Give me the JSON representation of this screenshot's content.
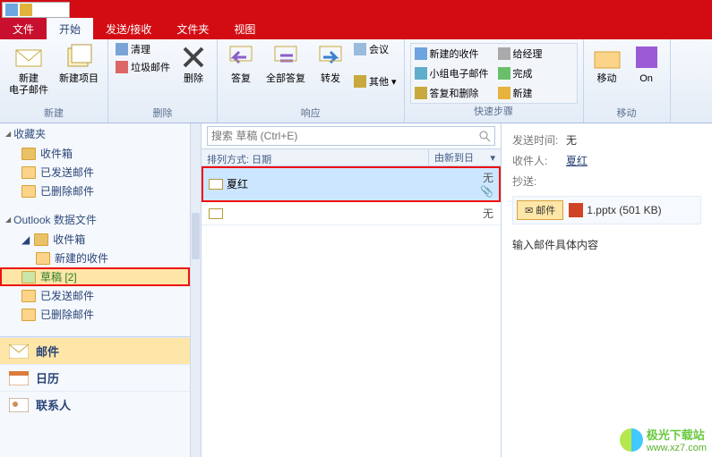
{
  "tabs": {
    "file": "文件",
    "home": "开始",
    "sendrecv": "发送/接收",
    "folder": "文件夹",
    "view": "视图"
  },
  "ribbon": {
    "new": {
      "label": "新建",
      "newmail": "新建\n电子邮件",
      "newitem": "新建项目"
    },
    "delete": {
      "label": "删除",
      "clean": "清理",
      "junk": "垃圾邮件",
      "del": "删除"
    },
    "respond": {
      "label": "响应",
      "reply": "答复",
      "replyall": "全部答复",
      "forward": "转发",
      "meeting": "会议",
      "other": "其他"
    },
    "quick": {
      "label": "快速步骤",
      "movemsg": "新建的收件",
      "team": "小组电子邮件",
      "replydel": "答复和删除",
      "mgr": "给经理",
      "done": "完成",
      "new": "新建"
    },
    "move": {
      "label": "移动",
      "move": "移动",
      "one": "On"
    }
  },
  "nav": {
    "fav": "收藏夹",
    "inbox": "收件箱",
    "sent": "已发送邮件",
    "deleted": "已删除邮件",
    "datafile": "Outlook 数据文件",
    "newfolder": "新建的收件",
    "drafts": "草稿 [2]",
    "mail": "邮件",
    "calendar": "日历",
    "contacts": "联系人"
  },
  "search": {
    "placeholder": "搜索 草稿 (Ctrl+E)"
  },
  "sort": {
    "by": "排列方式: 日期",
    "order": "由新到日"
  },
  "messages": [
    {
      "from": "夏红",
      "date": "无",
      "attach": true
    },
    {
      "from": "",
      "date": "无",
      "attach": false
    }
  ],
  "reading": {
    "sent_lbl": "发送时间:",
    "sent_val": "无",
    "to_lbl": "收件人:",
    "to_val": "夏红",
    "cc_lbl": "抄送:",
    "att_tab": "邮件",
    "att_file": "1.pptx (501 KB)",
    "body": "输入邮件具体内容"
  },
  "watermark": {
    "name": "极光下载站",
    "url": "www.xz7.com"
  }
}
